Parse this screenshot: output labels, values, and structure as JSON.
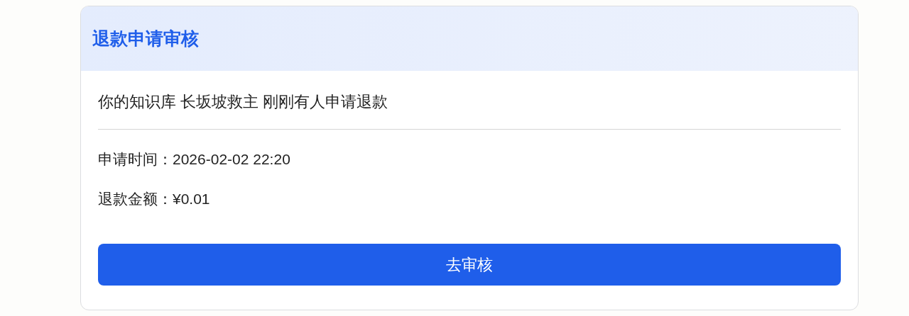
{
  "card": {
    "title": "退款申请审核",
    "message": "你的知识库 长坂坡救主 刚刚有人申请退款",
    "details": [
      "申请时间：2026-02-02 22:20",
      "退款金额：¥0.01"
    ],
    "button": "去审核"
  }
}
